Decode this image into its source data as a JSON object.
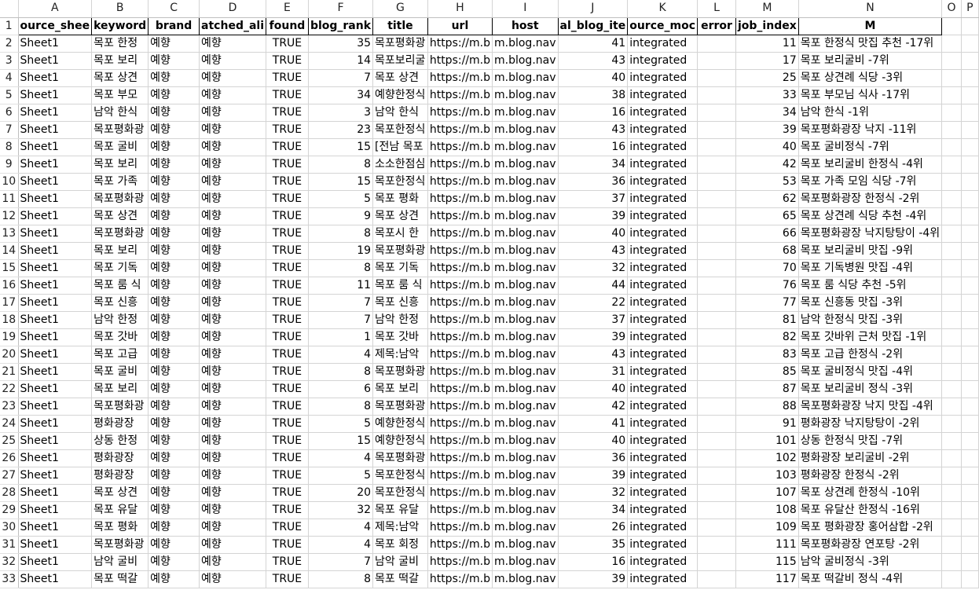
{
  "columns": [
    "A",
    "B",
    "C",
    "D",
    "E",
    "F",
    "G",
    "H",
    "I",
    "J",
    "K",
    "L",
    "M",
    "N",
    "O",
    "P"
  ],
  "headers": [
    "ource_shee",
    "keyword",
    "brand",
    "atched_ali",
    "found",
    "blog_rank",
    "title",
    "url",
    "host",
    "al_blog_ite",
    "ource_moc",
    "error",
    "job_index",
    "M",
    "",
    ""
  ],
  "rows": [
    {
      "num": "2",
      "a": "Sheet1",
      "b": "목포 한정",
      "c": "예향",
      "d": "예향",
      "e": "TRUE",
      "f": "35",
      "g": "목포평화광",
      "h": "https://m.b",
      "i": "m.blog.nav",
      "j": "41",
      "k": "integrated",
      "l": "",
      "m": "11",
      "n": "목포 한정식 맛집 추천 -17위"
    },
    {
      "num": "3",
      "a": "Sheet1",
      "b": "목포 보리",
      "c": "예향",
      "d": "예향",
      "e": "TRUE",
      "f": "14",
      "g": "목포보리굴",
      "h": "https://m.b",
      "i": "m.blog.nav",
      "j": "43",
      "k": "integrated",
      "l": "",
      "m": "17",
      "n": "목포 보리굴비 -7위"
    },
    {
      "num": "4",
      "a": "Sheet1",
      "b": "목포 상견",
      "c": "예향",
      "d": "예향",
      "e": "TRUE",
      "f": "7",
      "g": "목포 상견",
      "h": "https://m.b",
      "i": "m.blog.nav",
      "j": "40",
      "k": "integrated",
      "l": "",
      "m": "25",
      "n": "목포 상견례 식당 -3위"
    },
    {
      "num": "5",
      "a": "Sheet1",
      "b": "목포 부모",
      "c": "예향",
      "d": "예향",
      "e": "TRUE",
      "f": "34",
      "g": "예향한정식",
      "h": "https://m.b",
      "i": "m.blog.nav",
      "j": "38",
      "k": "integrated",
      "l": "",
      "m": "33",
      "n": "목포 부모님 식사 -17위"
    },
    {
      "num": "6",
      "a": "Sheet1",
      "b": "남악 한식",
      "c": "예향",
      "d": "예향",
      "e": "TRUE",
      "f": "3",
      "g": "남악 한식",
      "h": "https://m.b",
      "i": "m.blog.nav",
      "j": "16",
      "k": "integrated",
      "l": "",
      "m": "34",
      "n": "남악 한식 -1위"
    },
    {
      "num": "7",
      "a": "Sheet1",
      "b": "목포평화광",
      "c": "예향",
      "d": "예향",
      "e": "TRUE",
      "f": "23",
      "g": "목포한정식",
      "h": "https://m.b",
      "i": "m.blog.nav",
      "j": "43",
      "k": "integrated",
      "l": "",
      "m": "39",
      "n": "목포평화광장 낙지 -11위"
    },
    {
      "num": "8",
      "a": "Sheet1",
      "b": "목포 굴비",
      "c": "예향",
      "d": "예향",
      "e": "TRUE",
      "f": "15",
      "g": "[전남 목포",
      "h": "https://m.b",
      "i": "m.blog.nav",
      "j": "16",
      "k": "integrated",
      "l": "",
      "m": "40",
      "n": "목포 굴비정식 -7위"
    },
    {
      "num": "9",
      "a": "Sheet1",
      "b": "목포 보리",
      "c": "예향",
      "d": "예향",
      "e": "TRUE",
      "f": "8",
      "g": "소소한점심",
      "h": "https://m.b",
      "i": "m.blog.nav",
      "j": "34",
      "k": "integrated",
      "l": "",
      "m": "42",
      "n": "목포 보리굴비 한정식 -4위"
    },
    {
      "num": "10",
      "a": "Sheet1",
      "b": "목포 가족",
      "c": "예향",
      "d": "예향",
      "e": "TRUE",
      "f": "15",
      "g": "목포한정식",
      "h": "https://m.b",
      "i": "m.blog.nav",
      "j": "36",
      "k": "integrated",
      "l": "",
      "m": "53",
      "n": "목포 가족 모임 식당 -7위"
    },
    {
      "num": "11",
      "a": "Sheet1",
      "b": "목포평화광",
      "c": "예향",
      "d": "예향",
      "e": "TRUE",
      "f": "5",
      "g": "목포 평화",
      "h": "https://m.b",
      "i": "m.blog.nav",
      "j": "37",
      "k": "integrated",
      "l": "",
      "m": "62",
      "n": "목포평화광장 한정식 -2위"
    },
    {
      "num": "12",
      "a": "Sheet1",
      "b": "목포 상견",
      "c": "예향",
      "d": "예향",
      "e": "TRUE",
      "f": "9",
      "g": "목포 상견",
      "h": "https://m.b",
      "i": "m.blog.nav",
      "j": "39",
      "k": "integrated",
      "l": "",
      "m": "65",
      "n": "목포 상견례 식당 추천 -4위"
    },
    {
      "num": "13",
      "a": "Sheet1",
      "b": "목포평화광",
      "c": "예향",
      "d": "예향",
      "e": "TRUE",
      "f": "8",
      "g": "목포시 한",
      "h": "https://m.b",
      "i": "m.blog.nav",
      "j": "40",
      "k": "integrated",
      "l": "",
      "m": "66",
      "n": "목포평화광장 낙지탕탕이 -4위"
    },
    {
      "num": "14",
      "a": "Sheet1",
      "b": "목포 보리",
      "c": "예향",
      "d": "예향",
      "e": "TRUE",
      "f": "19",
      "g": "목포평화광",
      "h": "https://m.b",
      "i": "m.blog.nav",
      "j": "43",
      "k": "integrated",
      "l": "",
      "m": "68",
      "n": "목포 보리굴비 맛집 -9위"
    },
    {
      "num": "15",
      "a": "Sheet1",
      "b": "목포 기독",
      "c": "예향",
      "d": "예향",
      "e": "TRUE",
      "f": "8",
      "g": "목포 기독",
      "h": "https://m.b",
      "i": "m.blog.nav",
      "j": "32",
      "k": "integrated",
      "l": "",
      "m": "70",
      "n": "목포 기독병원 맛집 -4위"
    },
    {
      "num": "16",
      "a": "Sheet1",
      "b": "목포 룸 식",
      "c": "예향",
      "d": "예향",
      "e": "TRUE",
      "f": "11",
      "g": "목포 룸 식",
      "h": "https://m.b",
      "i": "m.blog.nav",
      "j": "44",
      "k": "integrated",
      "l": "",
      "m": "76",
      "n": "목포 룸 식당 추천 -5위"
    },
    {
      "num": "17",
      "a": "Sheet1",
      "b": "목포 신흥",
      "c": "예향",
      "d": "예향",
      "e": "TRUE",
      "f": "7",
      "g": "목포 신흥",
      "h": "https://m.b",
      "i": "m.blog.nav",
      "j": "22",
      "k": "integrated",
      "l": "",
      "m": "77",
      "n": "목포 신흥동 맛집 -3위"
    },
    {
      "num": "18",
      "a": "Sheet1",
      "b": "남악 한정",
      "c": "예향",
      "d": "예향",
      "e": "TRUE",
      "f": "7",
      "g": "남악 한정",
      "h": "https://m.b",
      "i": "m.blog.nav",
      "j": "37",
      "k": "integrated",
      "l": "",
      "m": "81",
      "n": "남악 한정식 맛집 -3위"
    },
    {
      "num": "19",
      "a": "Sheet1",
      "b": "목포 갓바",
      "c": "예향",
      "d": "예향",
      "e": "TRUE",
      "f": "1",
      "g": "목포 갓바",
      "h": "https://m.b",
      "i": "m.blog.nav",
      "j": "39",
      "k": "integrated",
      "l": "",
      "m": "82",
      "n": "목포 갓바위 근처 맛집 -1위"
    },
    {
      "num": "20",
      "a": "Sheet1",
      "b": "목포 고급",
      "c": "예향",
      "d": "예향",
      "e": "TRUE",
      "f": "4",
      "g": "제목:남악",
      "h": "https://m.b",
      "i": "m.blog.nav",
      "j": "43",
      "k": "integrated",
      "l": "",
      "m": "83",
      "n": "목포 고급 한정식 -2위"
    },
    {
      "num": "21",
      "a": "Sheet1",
      "b": "목포 굴비",
      "c": "예향",
      "d": "예향",
      "e": "TRUE",
      "f": "8",
      "g": "목포평화광",
      "h": "https://m.b",
      "i": "m.blog.nav",
      "j": "31",
      "k": "integrated",
      "l": "",
      "m": "85",
      "n": "목포 굴비정식 맛집 -4위"
    },
    {
      "num": "22",
      "a": "Sheet1",
      "b": "목포 보리",
      "c": "예향",
      "d": "예향",
      "e": "TRUE",
      "f": "6",
      "g": "목포 보리",
      "h": "https://m.b",
      "i": "m.blog.nav",
      "j": "40",
      "k": "integrated",
      "l": "",
      "m": "87",
      "n": "목포 보리굴비 정식 -3위"
    },
    {
      "num": "23",
      "a": "Sheet1",
      "b": "목포평화광",
      "c": "예향",
      "d": "예향",
      "e": "TRUE",
      "f": "8",
      "g": "목포평화광",
      "h": "https://m.b",
      "i": "m.blog.nav",
      "j": "42",
      "k": "integrated",
      "l": "",
      "m": "88",
      "n": "목포평화광장 낙지 맛집 -4위"
    },
    {
      "num": "24",
      "a": "Sheet1",
      "b": "평화광장",
      "c": "예향",
      "d": "예향",
      "e": "TRUE",
      "f": "5",
      "g": "예향한정식",
      "h": "https://m.b",
      "i": "m.blog.nav",
      "j": "41",
      "k": "integrated",
      "l": "",
      "m": "91",
      "n": "평화광장 낙지탕탕이 -2위"
    },
    {
      "num": "25",
      "a": "Sheet1",
      "b": "상동 한정",
      "c": "예향",
      "d": "예향",
      "e": "TRUE",
      "f": "15",
      "g": "예향한정식",
      "h": "https://m.b",
      "i": "m.blog.nav",
      "j": "40",
      "k": "integrated",
      "l": "",
      "m": "101",
      "n": "상동 한정식 맛집 -7위"
    },
    {
      "num": "26",
      "a": "Sheet1",
      "b": "평화광장",
      "c": "예향",
      "d": "예향",
      "e": "TRUE",
      "f": "4",
      "g": "목포평화광",
      "h": "https://m.b",
      "i": "m.blog.nav",
      "j": "36",
      "k": "integrated",
      "l": "",
      "m": "102",
      "n": "평화광장 보리굴비 -2위"
    },
    {
      "num": "27",
      "a": "Sheet1",
      "b": "평화광장",
      "c": "예향",
      "d": "예향",
      "e": "TRUE",
      "f": "5",
      "g": "목포한정식",
      "h": "https://m.b",
      "i": "m.blog.nav",
      "j": "39",
      "k": "integrated",
      "l": "",
      "m": "103",
      "n": "평화광장 한정식 -2위"
    },
    {
      "num": "28",
      "a": "Sheet1",
      "b": "목포 상견",
      "c": "예향",
      "d": "예향",
      "e": "TRUE",
      "f": "20",
      "g": "목포한정식",
      "h": "https://m.b",
      "i": "m.blog.nav",
      "j": "32",
      "k": "integrated",
      "l": "",
      "m": "107",
      "n": "목포 상견례 한정식 -10위"
    },
    {
      "num": "29",
      "a": "Sheet1",
      "b": "목포 유달",
      "c": "예향",
      "d": "예향",
      "e": "TRUE",
      "f": "32",
      "g": "목포 유달",
      "h": "https://m.b",
      "i": "m.blog.nav",
      "j": "34",
      "k": "integrated",
      "l": "",
      "m": "108",
      "n": "목포 유달산 한정식 -16위"
    },
    {
      "num": "30",
      "a": "Sheet1",
      "b": "목포 평화",
      "c": "예향",
      "d": "예향",
      "e": "TRUE",
      "f": "4",
      "g": "제목:남악",
      "h": "https://m.b",
      "i": "m.blog.nav",
      "j": "26",
      "k": "integrated",
      "l": "",
      "m": "109",
      "n": "목포 평화광장 홍어삼합 -2위"
    },
    {
      "num": "31",
      "a": "Sheet1",
      "b": "목포평화광",
      "c": "예향",
      "d": "예향",
      "e": "TRUE",
      "f": "4",
      "g": "목포 회정",
      "h": "https://m.b",
      "i": "m.blog.nav",
      "j": "35",
      "k": "integrated",
      "l": "",
      "m": "111",
      "n": "목포평화광장 연포탕 -2위"
    },
    {
      "num": "32",
      "a": "Sheet1",
      "b": "남악 굴비",
      "c": "예향",
      "d": "예향",
      "e": "TRUE",
      "f": "7",
      "g": "남악 굴비",
      "h": "https://m.b",
      "i": "m.blog.nav",
      "j": "16",
      "k": "integrated",
      "l": "",
      "m": "115",
      "n": "남악 굴비정식 -3위"
    },
    {
      "num": "33",
      "a": "Sheet1",
      "b": "목포 떡갈",
      "c": "예향",
      "d": "예향",
      "e": "TRUE",
      "f": "8",
      "g": "목포 떡갈",
      "h": "https://m.b",
      "i": "m.blog.nav",
      "j": "39",
      "k": "integrated",
      "l": "",
      "m": "117",
      "n": "목포 떡갈비 정식 -4위"
    }
  ]
}
